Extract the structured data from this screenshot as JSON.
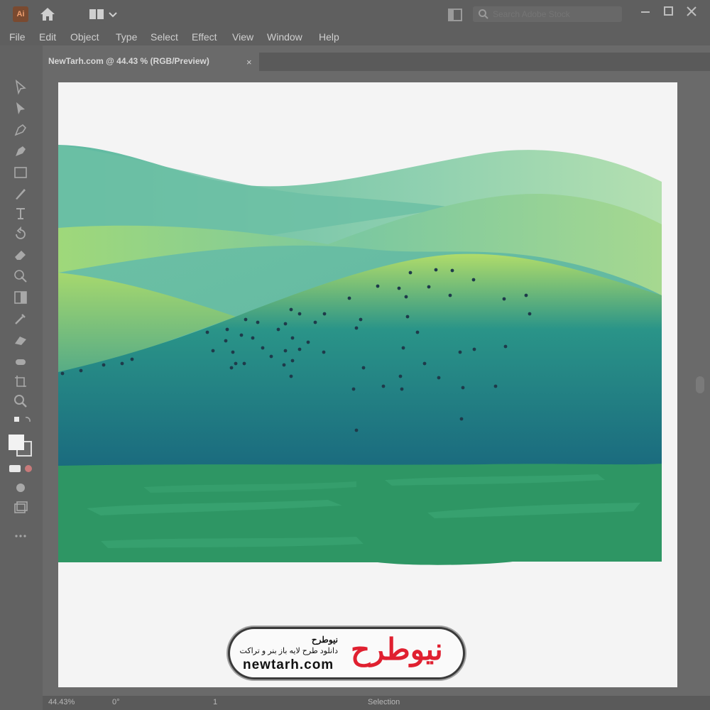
{
  "app": {
    "logo_text": "Ai",
    "search_placeholder": "Search Adobe Stock"
  },
  "menu": {
    "items": [
      "File",
      "Edit",
      "Object",
      "Type",
      "Select",
      "Effect",
      "View",
      "Window",
      "Help"
    ]
  },
  "document_tab": {
    "label": "NewTarh.com @ 44.43 % (RGB/Preview)",
    "close": "×"
  },
  "status": {
    "zoom": "44.43%",
    "angle": "0°",
    "page": "1",
    "tool": "Selection"
  },
  "watermark": {
    "logo_word": "نیوطرح",
    "title": "نیوطرح",
    "subtitle": "دانلود طرح لایه باز بنر و تراکت",
    "url": "newtarh.com"
  },
  "colors": {
    "ui_dark": "#5f5f5f",
    "artboard": "#f4f4f4",
    "hill_light": "#a8d878",
    "hill_teal": "#1e7f86",
    "ground_green": "#2e9664",
    "brand_red": "#e02030"
  },
  "icons": [
    "home-icon",
    "search-icon",
    "selection-tool-icon",
    "direct-selection-tool-icon",
    "pen-tool-icon",
    "curvature-tool-icon",
    "rectangle-tool-icon",
    "paintbrush-tool-icon",
    "type-tool-icon",
    "rotate-tool-icon",
    "eraser-tool-icon",
    "shape-builder-tool-icon",
    "gradient-tool-icon",
    "eyedropper-tool-icon",
    "blend-tool-icon",
    "symbol-sprayer-tool-icon",
    "artboard-tool-icon",
    "zoom-tool-icon",
    "fill-stroke-icon",
    "draw-mode-icon",
    "screen-mode-icon",
    "more-tools-icon"
  ]
}
